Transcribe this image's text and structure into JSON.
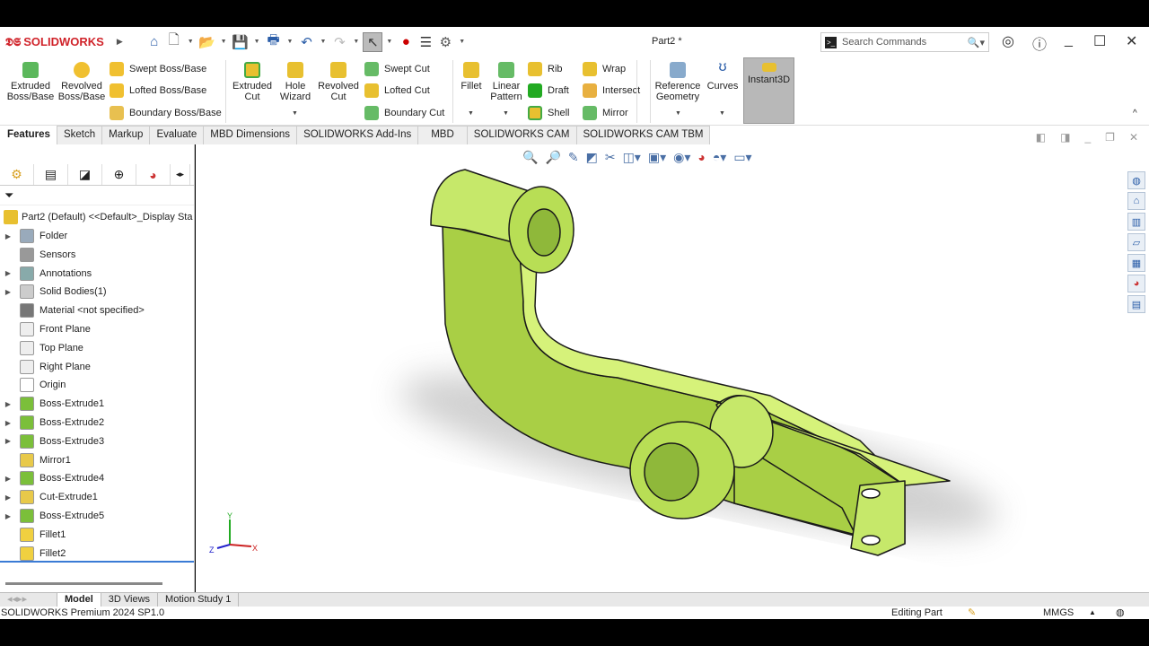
{
  "app": {
    "brand": "SOLIDWORKS",
    "doc_title": "Part2 *",
    "search_placeholder": "Search Commands"
  },
  "ribbon": {
    "extruded_boss": "Extruded Boss/Base",
    "revolved_boss": "Revolved Boss/Base",
    "swept_boss": "Swept Boss/Base",
    "lofted_boss": "Lofted Boss/Base",
    "boundary_boss": "Boundary Boss/Base",
    "extruded_cut": "Extruded Cut",
    "hole_wizard": "Hole Wizard",
    "revolved_cut": "Revolved Cut",
    "swept_cut": "Swept Cut",
    "lofted_cut": "Lofted Cut",
    "boundary_cut": "Boundary Cut",
    "fillet": "Fillet",
    "linear_pattern": "Linear Pattern",
    "rib": "Rib",
    "draft": "Draft",
    "shell": "Shell",
    "wrap": "Wrap",
    "intersect": "Intersect",
    "mirror": "Mirror",
    "reference_geometry": "Reference Geometry",
    "curves": "Curves",
    "instant3d": "Instant3D"
  },
  "tabs": [
    "Features",
    "Sketch",
    "Markup",
    "Evaluate",
    "MBD Dimensions",
    "SOLIDWORKS Add-Ins",
    "MBD",
    "SOLIDWORKS CAM",
    "SOLIDWORKS CAM TBM"
  ],
  "tree": {
    "root": "Part2 (Default) <<Default>_Display Sta",
    "items": [
      {
        "label": "Folder",
        "exp": true,
        "color": "#9ab"
      },
      {
        "label": "Sensors",
        "exp": false,
        "color": "#999"
      },
      {
        "label": "Annotations",
        "exp": true,
        "color": "#8aa"
      },
      {
        "label": "Solid Bodies(1)",
        "exp": true,
        "color": "#ccc"
      },
      {
        "label": "Material <not specified>",
        "exp": false,
        "color": "#777"
      },
      {
        "label": "Front Plane",
        "exp": false,
        "color": "#eee"
      },
      {
        "label": "Top Plane",
        "exp": false,
        "color": "#eee"
      },
      {
        "label": "Right Plane",
        "exp": false,
        "color": "#eee"
      },
      {
        "label": "Origin",
        "exp": false,
        "color": "#fff"
      },
      {
        "label": "Boss-Extrude1",
        "exp": true,
        "color": "#7bbf3a"
      },
      {
        "label": "Boss-Extrude2",
        "exp": true,
        "color": "#7bbf3a"
      },
      {
        "label": "Boss-Extrude3",
        "exp": true,
        "color": "#7bbf3a"
      },
      {
        "label": "Mirror1",
        "exp": false,
        "color": "#e8c94a"
      },
      {
        "label": "Boss-Extrude4",
        "exp": true,
        "color": "#7bbf3a"
      },
      {
        "label": "Cut-Extrude1",
        "exp": true,
        "color": "#e8c94a"
      },
      {
        "label": "Boss-Extrude5",
        "exp": true,
        "color": "#7bbf3a"
      },
      {
        "label": "Fillet1",
        "exp": false,
        "color": "#f0d040"
      },
      {
        "label": "Fillet2",
        "exp": false,
        "color": "#f0d040"
      }
    ]
  },
  "bottom_tabs": [
    "Model",
    "3D Views",
    "Motion Study 1"
  ],
  "status": {
    "version": "SOLIDWORKS Premium 2024 SP1.0",
    "mode": "Editing Part",
    "units": "MMGS"
  },
  "triad": {
    "x": "X",
    "y": "Y",
    "z": "Z"
  },
  "colors": {
    "part": "#c6e86a",
    "accent": "#d0232a"
  }
}
